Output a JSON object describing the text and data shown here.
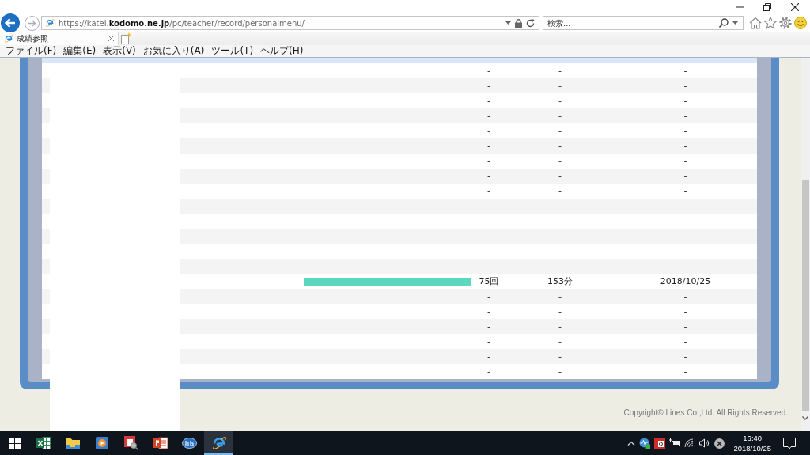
{
  "address_bar": {
    "url": "https://katei.**kodomo.ne.jp**/pc/teacher/record/personalmenu/"
  },
  "search": {
    "placeholder": "検索..."
  },
  "tabs": [
    {
      "title": "成績参照",
      "selected": true
    }
  ],
  "menu": [
    "ファイル(F)",
    "編集(E)",
    "表示(V)",
    "お気に入り(A)",
    "ツール(T)",
    "ヘルプ(H)"
  ],
  "table": {
    "rows": [
      {
        "kind": "plain",
        "count": "-",
        "time": "-",
        "date": "-"
      },
      {
        "kind": "plain",
        "count": "-",
        "time": "-",
        "date": "-"
      },
      {
        "kind": "plain",
        "count": "-",
        "time": "-",
        "date": "-"
      },
      {
        "kind": "plain",
        "count": "-",
        "time": "-",
        "date": "-"
      },
      {
        "kind": "plain",
        "count": "-",
        "time": "-",
        "date": "-"
      },
      {
        "kind": "plain",
        "count": "-",
        "time": "-",
        "date": "-"
      },
      {
        "kind": "plain",
        "count": "-",
        "time": "-",
        "date": "-"
      },
      {
        "kind": "plain",
        "count": "-",
        "time": "-",
        "date": "-"
      },
      {
        "kind": "plain",
        "count": "-",
        "time": "-",
        "date": "-"
      },
      {
        "kind": "plain",
        "count": "-",
        "time": "-",
        "date": "-"
      },
      {
        "kind": "plain",
        "count": "-",
        "time": "-",
        "date": "-"
      },
      {
        "kind": "plain",
        "count": "-",
        "time": "-",
        "date": "-"
      },
      {
        "kind": "plain",
        "count": "-",
        "time": "-",
        "date": "-"
      },
      {
        "kind": "plain",
        "count": "-",
        "time": "-",
        "date": "-"
      },
      {
        "kind": "bar",
        "count": "75回",
        "time": "153分",
        "date": "2018/10/25"
      },
      {
        "kind": "plain",
        "count": "-",
        "time": "-",
        "date": "-"
      },
      {
        "kind": "plain",
        "count": "-",
        "time": "-",
        "date": "-"
      },
      {
        "kind": "plain",
        "count": "-",
        "time": "-",
        "date": "-"
      },
      {
        "kind": "plain",
        "count": "-",
        "time": "-",
        "date": "-"
      },
      {
        "kind": "plain",
        "count": "-",
        "time": "-",
        "date": "-"
      },
      {
        "kind": "plain",
        "count": "-",
        "time": "-",
        "date": "-"
      }
    ]
  },
  "footer": {
    "copyright": "Copyright© Lines Co.,Ltd. All Rights Reserved."
  },
  "taskbar": {
    "apps": [
      {
        "kind": "spreadsheet",
        "selected": false
      },
      {
        "kind": "folder",
        "selected": false
      },
      {
        "kind": "media",
        "selected": false
      },
      {
        "kind": "viewer",
        "selected": false
      },
      {
        "kind": "presentation",
        "selected": false
      },
      {
        "kind": "library",
        "selected": false
      },
      {
        "kind": "browser",
        "selected": true
      }
    ],
    "clock": {
      "time": "16:40",
      "date": "2018/10/25"
    }
  }
}
